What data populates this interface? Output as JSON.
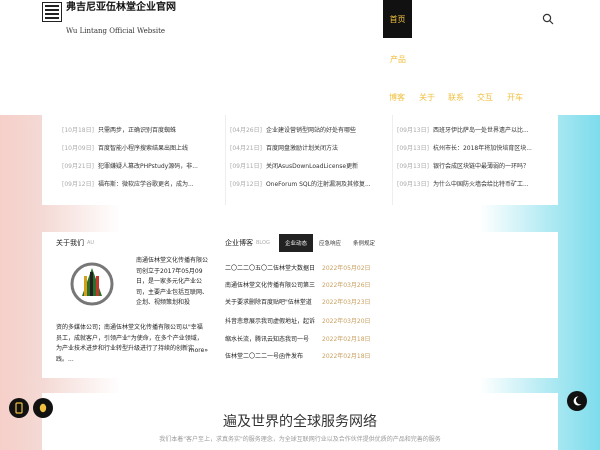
{
  "brand": {
    "title": "弗吉尼亚伍林堂企业官网",
    "subtitle": "Wu Lintang Official Website"
  },
  "nav": {
    "home": "首页",
    "items": [
      "产品",
      "博客",
      "关于",
      "联系",
      "交互",
      "开车"
    ]
  },
  "news": {
    "col1": [
      {
        "date": "[10月18日]",
        "title": "只需两步，正确识别百度蜘蛛"
      },
      {
        "date": "[10月09日]",
        "title": "百度智能小程序搜索结果出图上线"
      },
      {
        "date": "[09月21日]",
        "title": "犯罪嫌疑人篡改PHPstudy源码，非..."
      },
      {
        "date": "[09月12日]",
        "title": "福布斯：微软应学谷歌更名，成为..."
      }
    ],
    "col2": [
      {
        "date": "[04月26日]",
        "title": "企业建设营销型网站的好处有哪些"
      },
      {
        "date": "[04月21日]",
        "title": "百度网盘激励计划关闭方法"
      },
      {
        "date": "[09月11日]",
        "title": "关闭AsusDownLoadLicense更新"
      },
      {
        "date": "[09月12日]",
        "title": "OneForum SQL的注射漏洞及其修复..."
      }
    ],
    "col3": [
      {
        "date": "[09月13日]",
        "title": "西班牙伊比萨岛一处世界遗产以比..."
      },
      {
        "date": "[09月13日]",
        "title": "杭州市长：2018年将加快培育区块..."
      },
      {
        "date": "[09月13日]",
        "title": "银行会成区块链中最薄弱的一环吗？"
      },
      {
        "date": "[09月13日]",
        "title": "为什么中国防火墙会给比特币矿工..."
      }
    ]
  },
  "about": {
    "heading": "关于我们",
    "heading_en": "AU",
    "text_side": "南通伍林堂文化传播有限公司创立于2017年05月09日，是一家多元化产业公司，主要产业包括互联网、企划、视频策划和投",
    "text_full": "资的多媒体公司；南通伍林堂文化传播有限公司以\"幸福员工，成就客户，引领产业\"为使命，在多个产业领域，为产业技术进步和行业转型升级进行了持续的创新实践。...",
    "more": "more»"
  },
  "blog": {
    "heading": "企业博客",
    "heading_en": "BLOG",
    "tabs": [
      "企业动态",
      "应急响应",
      "条例规定"
    ],
    "rows": [
      {
        "title": "二〇二二〇五〇二伍林堂大数据日",
        "date": "2022年05月02日"
      },
      {
        "title": "南通伍林堂文化传播有限公司第三",
        "date": "2022年03月26日"
      },
      {
        "title": "关于要求删除百度贴吧\"伍林堂道",
        "date": "2022年03月23日"
      },
      {
        "title": "抖音悲意展示我司虚假地址，起诉",
        "date": "2022年03月20日"
      },
      {
        "title": "缩水长流，腾讯云知态我司一号",
        "date": "2022年02月18日"
      },
      {
        "title": "伍林堂二〇二二一号函件发布",
        "date": "2022年02月18日"
      }
    ]
  },
  "services": {
    "title": "遍及世界的全球服务网络",
    "subtitle": "我们本着\"客户至上，求真务实\"的服务理念，为全球互联网行业以及合作伙伴提供优质的产品和完善的服务"
  },
  "colors": {
    "nav_accent": "#f0c040",
    "blog_date": "#c8a060"
  }
}
